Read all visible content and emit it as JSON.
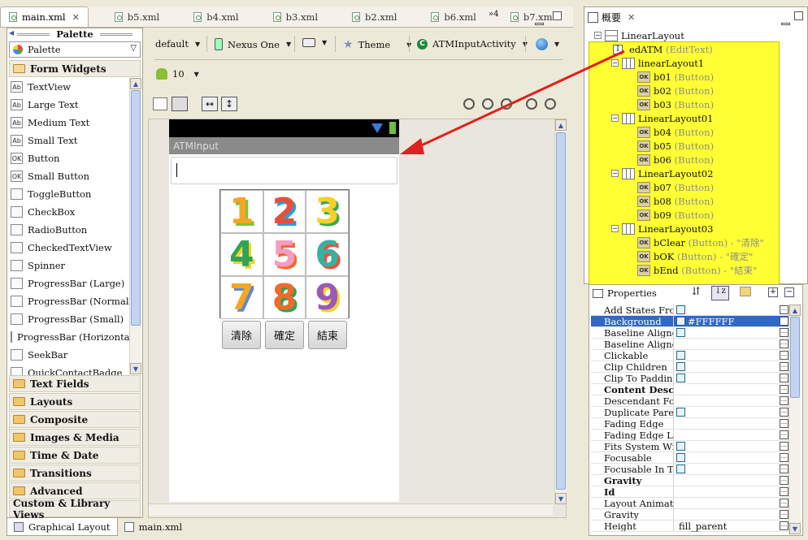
{
  "editor_tabs": [
    {
      "label": "main.xml",
      "active": true
    },
    {
      "label": "b5.xml"
    },
    {
      "label": "b4.xml"
    },
    {
      "label": "b3.xml"
    },
    {
      "label": "b2.xml"
    },
    {
      "label": "b6.xml"
    },
    {
      "label": "b7.xml"
    }
  ],
  "overflow_tabs": "»4",
  "palette": {
    "title": "Palette",
    "selector": "Palette",
    "open_category": "Form Widgets",
    "widgets": [
      "TextView",
      "Large Text",
      "Medium Text",
      "Small Text",
      "Button",
      "Small Button",
      "ToggleButton",
      "CheckBox",
      "RadioButton",
      "CheckedTextView",
      "Spinner",
      "ProgressBar (Large)",
      "ProgressBar (Normal)",
      "ProgressBar (Small)",
      "ProgressBar (Horizontal)",
      "SeekBar",
      "QuickContactBadge"
    ],
    "widget_icon_text": [
      "Ab",
      "Ab",
      "Ab",
      "Ab",
      "OK",
      "OK",
      "",
      "",
      "",
      "",
      "",
      "",
      "",
      "",
      "",
      "",
      ""
    ],
    "categories": [
      "Text Fields",
      "Layouts",
      "Composite",
      "Images & Media",
      "Time & Date",
      "Transitions",
      "Advanced",
      "Custom & Library Views"
    ]
  },
  "toolbar": {
    "config": "default",
    "device": "Nexus One",
    "theme": "Theme",
    "activity": "ATMInputActivity",
    "api_level": "10"
  },
  "device": {
    "title": "ATMInput",
    "digits": [
      "1",
      "2",
      "3",
      "4",
      "5",
      "6",
      "7",
      "8",
      "9"
    ],
    "buttons": [
      "清除",
      "確定",
      "結束"
    ]
  },
  "outline": {
    "title": "概要",
    "root": "LinearLayout",
    "edit": {
      "id": "edATM",
      "type": "(EditText)"
    },
    "groups": [
      {
        "name": "linearLayout1",
        "children": [
          {
            "id": "b01",
            "type": "(Button)"
          },
          {
            "id": "b02",
            "type": "(Button)"
          },
          {
            "id": "b03",
            "type": "(Button)"
          }
        ]
      },
      {
        "name": "LinearLayout01",
        "children": [
          {
            "id": "b04",
            "type": "(Button)"
          },
          {
            "id": "b05",
            "type": "(Button)"
          },
          {
            "id": "b06",
            "type": "(Button)"
          }
        ]
      },
      {
        "name": "LinearLayout02",
        "children": [
          {
            "id": "b07",
            "type": "(Button)"
          },
          {
            "id": "b08",
            "type": "(Button)"
          },
          {
            "id": "b09",
            "type": "(Button)"
          }
        ]
      },
      {
        "name": "LinearLayout03",
        "children": [
          {
            "id": "bClear",
            "type": "(Button)",
            "text": "- \"清除\""
          },
          {
            "id": "bOK",
            "type": "(Button)",
            "text": "- \"確定\""
          },
          {
            "id": "bEnd",
            "type": "(Button)",
            "text": "- \"結束\""
          }
        ]
      }
    ]
  },
  "properties": {
    "title": "Properties",
    "rows": [
      {
        "name": "Add States Fro...",
        "check": true
      },
      {
        "name": "Background",
        "check": true,
        "value": "#FFFFFF",
        "selected": true
      },
      {
        "name": "Baseline Aligned",
        "check": true
      },
      {
        "name": "Baseline Aligne..."
      },
      {
        "name": "Clickable",
        "check": true
      },
      {
        "name": "Clip Children",
        "check": true
      },
      {
        "name": "Clip To Padding",
        "check": true
      },
      {
        "name": "Content Desc...",
        "bold": true
      },
      {
        "name": "Descendant Foc..."
      },
      {
        "name": "Duplicate Parent...",
        "check": true
      },
      {
        "name": "Fading Edge"
      },
      {
        "name": "Fading Edge Le..."
      },
      {
        "name": "Fits System Win...",
        "check": true
      },
      {
        "name": "Focusable",
        "check": true
      },
      {
        "name": "Focusable In To...",
        "check": true
      },
      {
        "name": "Gravity",
        "bold": true
      },
      {
        "name": "Id",
        "bold": true
      },
      {
        "name": "Layout Animation"
      },
      {
        "name": "Gravity"
      },
      {
        "name": "Height",
        "value": "fill_parent"
      }
    ]
  },
  "bottom_tabs": [
    "Graphical Layout",
    "main.xml"
  ],
  "colors": {
    "highlight": "#FFFF33",
    "arrow": "#E02020",
    "selection": "#3168C6"
  }
}
